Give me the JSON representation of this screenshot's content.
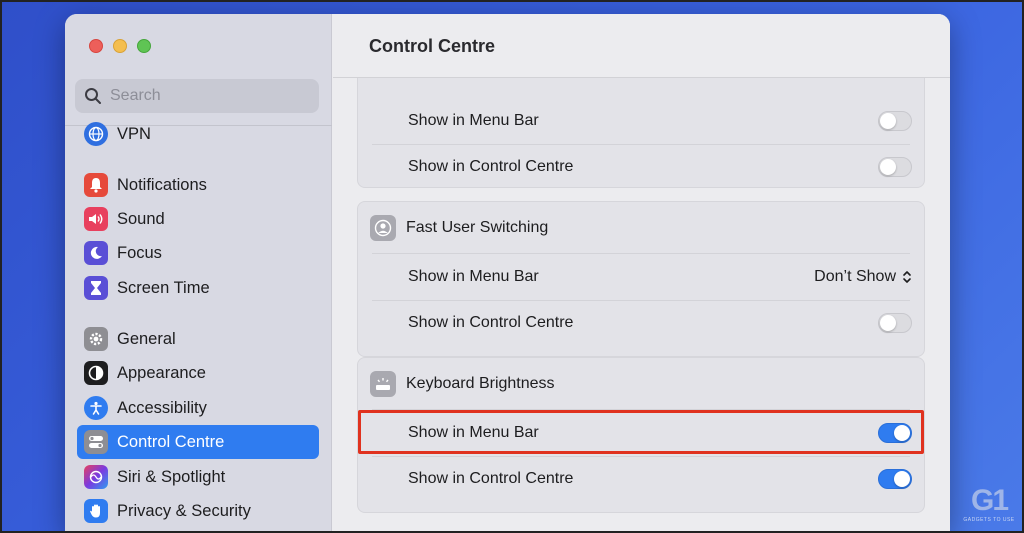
{
  "sidebar": {
    "search_placeholder": "Search",
    "items": [
      {
        "label": "VPN",
        "icon": "globe-icon",
        "color": "#2f6fe0"
      },
      {
        "label": "Notifications",
        "icon": "bell-icon",
        "color": "#e64a3b"
      },
      {
        "label": "Sound",
        "icon": "speaker-icon",
        "color": "#e8405e"
      },
      {
        "label": "Focus",
        "icon": "moon-icon",
        "color": "#5a4fd6"
      },
      {
        "label": "Screen Time",
        "icon": "hourglass-icon",
        "color": "#5a4fd6"
      },
      {
        "label": "General",
        "icon": "gear-icon",
        "color": "#8e8e93"
      },
      {
        "label": "Appearance",
        "icon": "appearance-icon",
        "color": "#1d1d1f"
      },
      {
        "label": "Accessibility",
        "icon": "accessibility-icon",
        "color": "#2f7cf0"
      },
      {
        "label": "Control Centre",
        "icon": "control-centre-icon",
        "color": "#8e8e93"
      },
      {
        "label": "Siri & Spotlight",
        "icon": "siri-icon",
        "color": "#7a3be0"
      },
      {
        "label": "Privacy & Security",
        "icon": "hand-icon",
        "color": "#2f7cf0"
      }
    ],
    "active": "Control Centre"
  },
  "main": {
    "title": "Control Centre",
    "sections": [
      {
        "title": "",
        "rows": [
          {
            "label": "Show in Menu Bar",
            "control": "toggle",
            "value": false
          },
          {
            "label": "Show in Control Centre",
            "control": "toggle",
            "value": false
          }
        ]
      },
      {
        "title": "Fast User Switching",
        "icon": "user-icon",
        "rows": [
          {
            "label": "Show in Menu Bar",
            "control": "select",
            "value": "Don’t Show"
          },
          {
            "label": "Show in Control Centre",
            "control": "toggle",
            "value": false
          }
        ]
      },
      {
        "title": "Keyboard Brightness",
        "icon": "keyboard-brightness-icon",
        "rows": [
          {
            "label": "Show in Menu Bar",
            "control": "toggle",
            "value": true,
            "highlighted": true
          },
          {
            "label": "Show in Control Centre",
            "control": "toggle",
            "value": true
          }
        ]
      }
    ]
  },
  "colors": {
    "accent": "#2f7cf0",
    "highlight_border": "#e0321f",
    "background": "#3a63e0"
  },
  "watermark": {
    "big": "G1",
    "small": "GADGETS TO USE"
  }
}
